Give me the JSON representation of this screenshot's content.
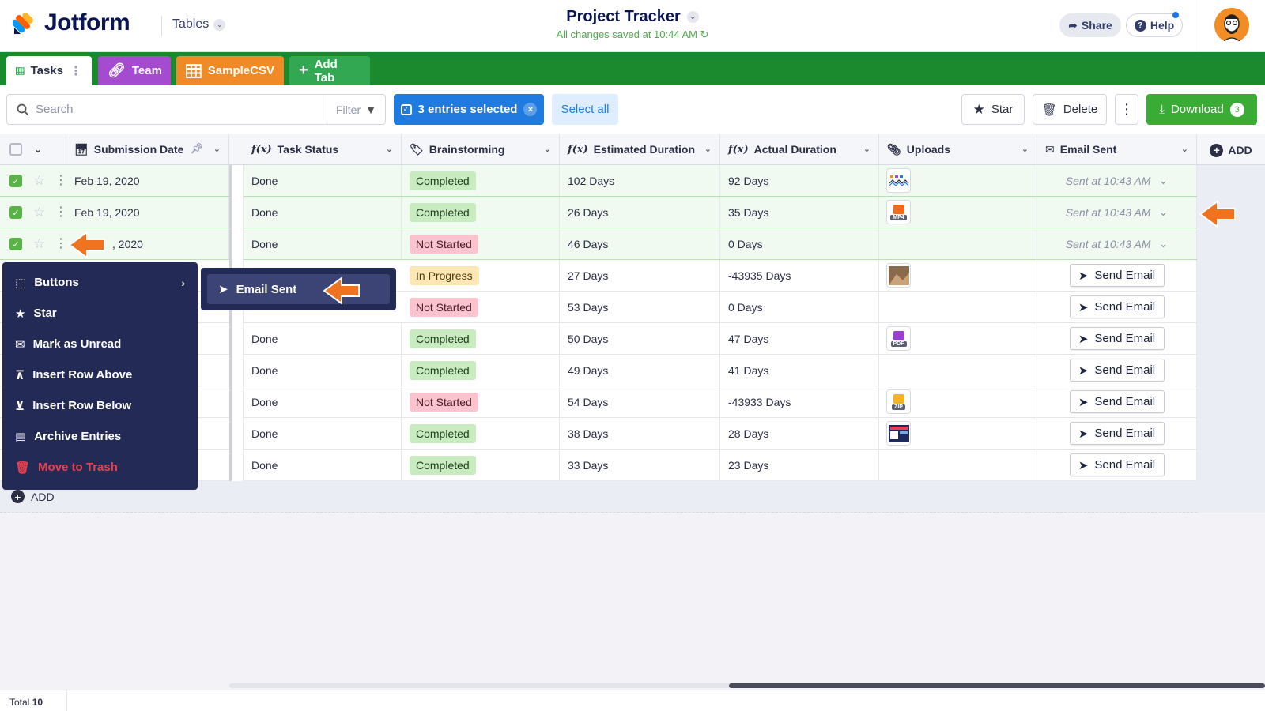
{
  "app": {
    "logo": "Jotform",
    "nav": "Tables",
    "title": "Project Tracker",
    "saved_status": "All changes saved at 10:44 AM"
  },
  "header": {
    "share_label": "Share",
    "help_label": "Help"
  },
  "tabs": [
    {
      "label": "Tasks",
      "color": "#ffffff"
    },
    {
      "label": "Team",
      "color": "#a54bd0"
    },
    {
      "label": "SampleCSV",
      "color": "#f08a27"
    },
    {
      "label": "Add Tab",
      "color": "#32a853"
    }
  ],
  "toolbar": {
    "search_placeholder": "Search",
    "filter_label": "Filter",
    "entries_selected": "3 entries selected",
    "select_all": "Select all",
    "star_label": "Star",
    "delete_label": "Delete",
    "download_label": "Download",
    "download_count": "3"
  },
  "columns": [
    "Submission Date",
    "Task Status",
    "Brainstorming",
    "Estimated Duration",
    "Actual Duration",
    "Uploads",
    "Email Sent"
  ],
  "add_column_label": "ADD",
  "rows": [
    {
      "date": "Feb 19, 2020",
      "status": "Done",
      "brainstorming": "Completed",
      "estimated": "102 Days",
      "actual": "92 Days",
      "upload": "image",
      "email": "Sent at 10:43 AM",
      "selected": true
    },
    {
      "date": "Feb 19, 2020",
      "status": "Done",
      "brainstorming": "Completed",
      "estimated": "26 Days",
      "actual": "35 Days",
      "upload": "MP4",
      "email": "Sent at 10:43 AM",
      "selected": true
    },
    {
      "date": ", 2020",
      "status": "Done",
      "brainstorming": "Not Started",
      "estimated": "46 Days",
      "actual": "0 Days",
      "upload": "",
      "email": "Sent at 10:43 AM",
      "selected": true
    },
    {
      "date": "",
      "status": "",
      "brainstorming": "In Progress",
      "estimated": "27 Days",
      "actual": "-43935 Days",
      "upload": "photo",
      "email": "Send Email",
      "selected": false
    },
    {
      "date": "",
      "status": "",
      "brainstorming": "Not Started",
      "estimated": "53 Days",
      "actual": "0 Days",
      "upload": "",
      "email": "Send Email",
      "selected": false
    },
    {
      "date": "",
      "status": "Done",
      "brainstorming": "Completed",
      "estimated": "50 Days",
      "actual": "47 Days",
      "upload": "PDF",
      "email": "Send Email",
      "selected": false
    },
    {
      "date": "",
      "status": "Done",
      "brainstorming": "Completed",
      "estimated": "49 Days",
      "actual": "41 Days",
      "upload": "",
      "email": "Send Email",
      "selected": false
    },
    {
      "date": "",
      "status": "Done",
      "brainstorming": "Not Started",
      "estimated": "54 Days",
      "actual": "-43933 Days",
      "upload": "ZIP",
      "email": "Send Email",
      "selected": false
    },
    {
      "date": "",
      "status": "Done",
      "brainstorming": "Completed",
      "estimated": "38 Days",
      "actual": "28 Days",
      "upload": "screenshot",
      "email": "Send Email",
      "selected": false
    },
    {
      "date": "",
      "status": "Done",
      "brainstorming": "Completed",
      "estimated": "33 Days",
      "actual": "23 Days",
      "upload": "",
      "email": "Send Email",
      "selected": false
    }
  ],
  "add_row_label": "ADD",
  "context_menu": [
    "Buttons",
    "Star",
    "Mark as Unread",
    "Insert Row Above",
    "Insert Row Below",
    "Archive Entries",
    "Move to Trash"
  ],
  "submenu": {
    "item": "Email Sent"
  },
  "footer": {
    "total_label": "Total",
    "total_value": "10"
  },
  "colors": {
    "brand_green": "#1b8a2f",
    "select_blue": "#1f7be0",
    "menu_bg": "#232a55",
    "annotation_orange": "#f0731f"
  }
}
